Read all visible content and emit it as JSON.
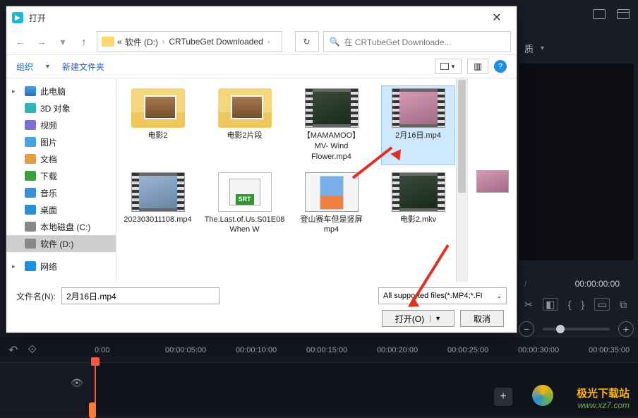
{
  "dialog": {
    "title": "打开",
    "nav": {
      "path_prefix": "«",
      "drive": "软件 (D:)",
      "folder": "CRTubeGet Downloaded",
      "search_placeholder": "在 CRTubeGet Downloade..."
    },
    "toolbar": {
      "organize": "组织",
      "new_folder": "新建文件夹"
    },
    "sidebar": [
      {
        "label": "此电脑",
        "icon": "sb-pc",
        "exp": true
      },
      {
        "label": "3D 对象",
        "icon": "sb-3d"
      },
      {
        "label": "视频",
        "icon": "sb-video"
      },
      {
        "label": "图片",
        "icon": "sb-pic"
      },
      {
        "label": "文档",
        "icon": "sb-doc"
      },
      {
        "label": "下载",
        "icon": "sb-dl"
      },
      {
        "label": "音乐",
        "icon": "sb-music"
      },
      {
        "label": "桌面",
        "icon": "sb-desk"
      },
      {
        "label": "本地磁盘 (C:)",
        "icon": "sb-drive"
      },
      {
        "label": "软件 (D:)",
        "icon": "sb-drive",
        "selected": true
      },
      {
        "label": "",
        "spacer": true
      },
      {
        "label": "网络",
        "icon": "sb-net",
        "exp": true
      }
    ],
    "files": [
      {
        "name": "电影2",
        "type": "folder"
      },
      {
        "name": "电影2片段",
        "type": "folder"
      },
      {
        "name": "【MAMAMOO】MV- Wind Flower.mp4",
        "type": "film",
        "variant": "dark"
      },
      {
        "name": "2月16日.mp4",
        "type": "film",
        "variant": "pink",
        "selected": true
      },
      {
        "name": "202303011108.mp4",
        "type": "film",
        "variant": "sky"
      },
      {
        "name": "The.Last.of.Us.S01E08 When W",
        "type": "srt"
      },
      {
        "name": "登山赛车但是竖屏    mp4",
        "type": "phone"
      },
      {
        "name": "电影2.mkv",
        "type": "film",
        "variant": "dark"
      }
    ],
    "filename_label": "文件名(N):",
    "filename_value": "2月16日.mp4",
    "filter_label": "All supported files(*.MP4;*.FI",
    "open_btn": "打开(O)",
    "cancel_btn": "取消"
  },
  "app": {
    "sec_row_label": "质",
    "timecode1": "",
    "timecode2": "00:00:00:00",
    "ruler": [
      "0:00",
      "00:00:05:00",
      "00:00:10:00",
      "00:00:15:00",
      "00:00:20:00",
      "00:00:25:00",
      "00:00:30:00",
      "00:00:35:00"
    ]
  },
  "watermark": {
    "brand": "极光下载站",
    "url": "www.xz7.com"
  }
}
